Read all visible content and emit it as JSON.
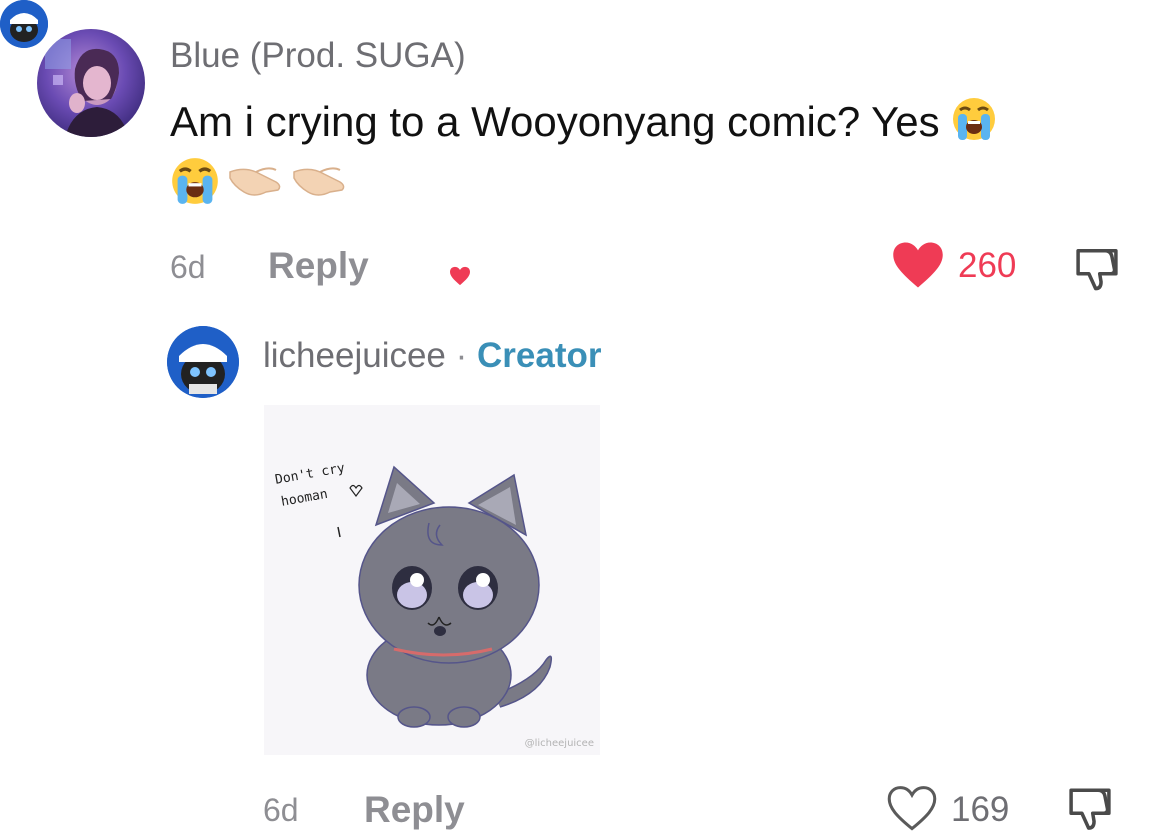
{
  "comment": {
    "username": "Blue (Prod. SUGA)",
    "text": "Am i crying to a Wooyonyang comic? Yes",
    "emojis": [
      "loudly-crying-face",
      "loudly-crying-face",
      "pinching-hand",
      "pinching-hand"
    ],
    "time": "6d",
    "reply_label": "Reply",
    "likes": "260",
    "liked": true,
    "liked_by_creator": true
  },
  "reply": {
    "username": "licheejuicee",
    "separator": "·",
    "creator_label": "Creator",
    "image": {
      "handwriting_line1": "Don't cry",
      "handwriting_line2": "hooman",
      "watermark": "@licheejuicee"
    },
    "time": "6d",
    "reply_label": "Reply",
    "likes": "169",
    "liked": false
  },
  "colors": {
    "like_red": "#ef3b55",
    "creator_blue": "#3a8fb7",
    "muted_gray": "#8e8e93"
  }
}
